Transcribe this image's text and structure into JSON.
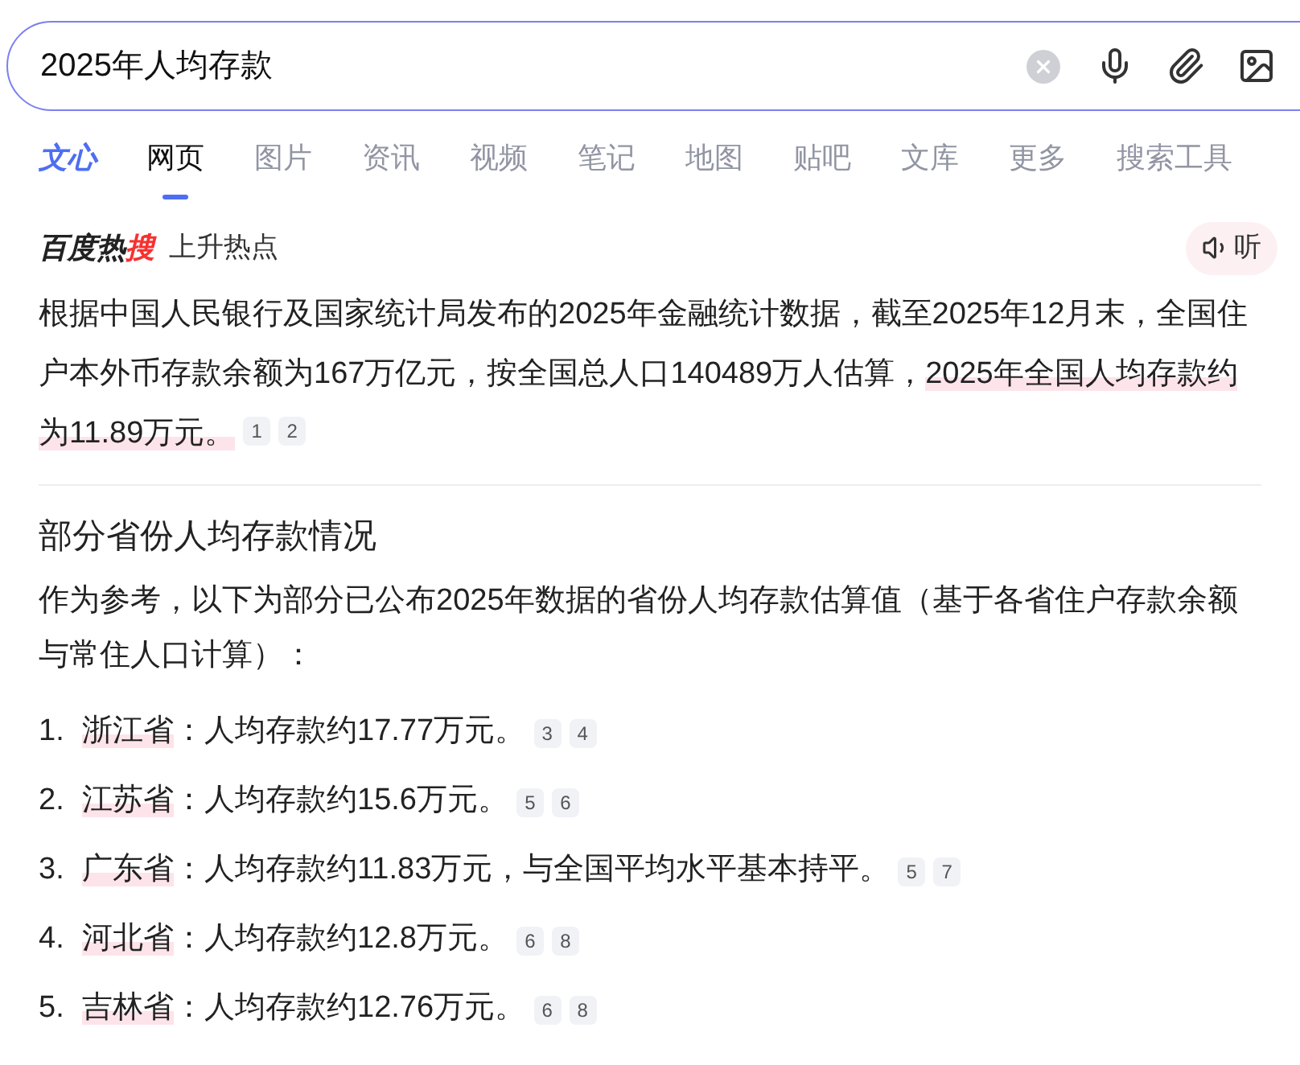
{
  "search": {
    "value": "2025年人均存款"
  },
  "tabs": [
    {
      "label": "文心",
      "kind": "brand",
      "selected": false
    },
    {
      "label": "网页",
      "kind": "tab",
      "selected": true
    },
    {
      "label": "图片",
      "kind": "tab",
      "selected": false
    },
    {
      "label": "资讯",
      "kind": "tab",
      "selected": false
    },
    {
      "label": "视频",
      "kind": "tab",
      "selected": false
    },
    {
      "label": "笔记",
      "kind": "tab",
      "selected": false
    },
    {
      "label": "地图",
      "kind": "tab",
      "selected": false
    },
    {
      "label": "贴吧",
      "kind": "tab",
      "selected": false
    },
    {
      "label": "文库",
      "kind": "tab",
      "selected": false
    },
    {
      "label": "更多",
      "kind": "tab",
      "selected": false
    },
    {
      "label": "搜索工具",
      "kind": "tab",
      "selected": false
    }
  ],
  "hot": {
    "logo": "百度热",
    "logo_accent": "搜",
    "label": "上升热点",
    "listen": "听"
  },
  "summary": {
    "segments": [
      {
        "text": "根据中国人民银行及国家统计局发布的2025年金融统计数据，截至2025年12月末，全国住户本外币存款余额为167万亿元，按全国总人口140489万人估算，",
        "highlighted": false
      },
      {
        "text": "2025年全国人均存款约为11.89万元。",
        "highlighted": true
      }
    ],
    "refs": [
      "1",
      "2"
    ]
  },
  "section": {
    "heading": "部分省份人均存款情况",
    "intro": "作为参考，以下为部分已公布2025年数据的省份人均存款估算值（基于各省住户存款余额与常住人口计算）：",
    "items": [
      {
        "number": "1.",
        "region": "浙江省",
        "text": "：人均存款约17.77万元。",
        "refs": [
          "3",
          "4"
        ]
      },
      {
        "number": "2.",
        "region": "江苏省",
        "text": "：人均存款约15.6万元。",
        "refs": [
          "5",
          "6"
        ]
      },
      {
        "number": "3.",
        "region": "广东省",
        "text": "：人均存款约11.83万元，与全国平均水平基本持平。",
        "refs": [
          "5",
          "7"
        ]
      },
      {
        "number": "4.",
        "region": "河北省",
        "text": "：人均存款约12.8万元。",
        "refs": [
          "6",
          "8"
        ]
      },
      {
        "number": "5.",
        "region": "吉林省",
        "text": "：人均存款约12.76万元。",
        "refs": [
          "6",
          "8"
        ]
      }
    ]
  }
}
